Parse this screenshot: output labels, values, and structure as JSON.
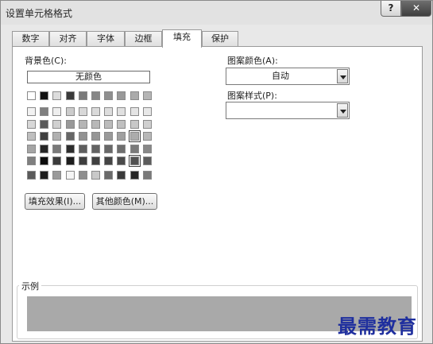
{
  "window": {
    "title": "设置单元格格式"
  },
  "titlebar": {
    "help": "?",
    "close": "✕"
  },
  "tabs": [
    {
      "label": "数字"
    },
    {
      "label": "对齐"
    },
    {
      "label": "字体"
    },
    {
      "label": "边框"
    },
    {
      "label": "填充",
      "active": true
    },
    {
      "label": "保护"
    }
  ],
  "fill": {
    "background_label": "背景色(C):",
    "no_color_label": "无颜色",
    "fill_effects_button": "填充效果(I)...",
    "more_colors_button": "其他颜色(M)...",
    "pattern_color_label": "图案颜色(A):",
    "pattern_color_value": "自动",
    "pattern_style_label": "图案样式(P):",
    "pattern_style_value": ""
  },
  "palette": {
    "theme_top": [
      "#ffffff",
      "#111111",
      "#dcdcdc",
      "#3a3a3a",
      "#7a7a7a",
      "#868686",
      "#8f8f8f",
      "#999999",
      "#aaaaaa",
      "#b5b5b5"
    ],
    "theme_tints": [
      [
        "#f2f2f2",
        "#7f7f7f",
        "#eeeeee",
        "#cccccc",
        "#d8d8d8",
        "#dadada",
        "#dddddd",
        "#e0e0e0",
        "#e4e4e4",
        "#e8e8e8"
      ],
      [
        "#d8d8d8",
        "#595959",
        "#d0d0d0",
        "#999999",
        "#b5b5b5",
        "#b8b8b8",
        "#bbbbbb",
        "#c0c0c0",
        "#c8c8c8",
        "#d0d0d0"
      ],
      [
        "#bfbfbf",
        "#3f3f3f",
        "#b0b0b0",
        "#666666",
        "#929292",
        "#969696",
        "#9a9a9a",
        "#a0a0a0",
        "#acacac",
        "#b8b8b8"
      ],
      [
        "#a5a5a5",
        "#262626",
        "#7a7a7a",
        "#2d2d2d",
        "#5e5e5e",
        "#626262",
        "#686868",
        "#6e6e6e",
        "#7a7a7a",
        "#888888"
      ],
      [
        "#7f7f7f",
        "#0c0c0c",
        "#3b3b3b",
        "#1d1d1d",
        "#3e3e3e",
        "#404040",
        "#444444",
        "#4a4a4a",
        "#525252",
        "#5c5c5c"
      ]
    ],
    "standard": [
      "#5a5a5a",
      "#1e1e1e",
      "#9a9a9a",
      "#f5f5f5",
      "#8e8e8e",
      "#c9c9c9",
      "#6a6a6a",
      "#3a3a3a",
      "#262626",
      "#7a7a7a"
    ]
  },
  "sample": {
    "label": "示例",
    "color": "#a9a9a9"
  },
  "watermark": {
    "text": "最需教育"
  }
}
